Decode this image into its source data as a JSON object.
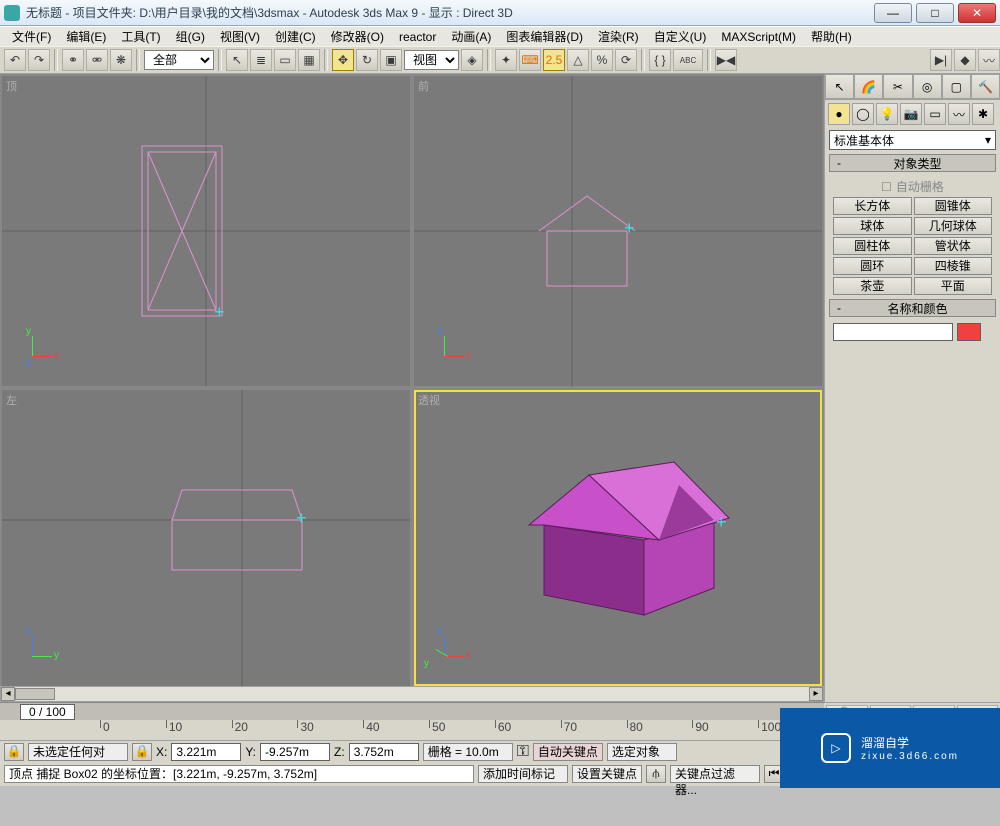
{
  "title": "无标题     - 项目文件夹: D:\\用户目录\\我的文档\\3dsmax      - Autodesk 3ds Max 9       - 显示 : Direct 3D",
  "menu": [
    "文件(F)",
    "编辑(E)",
    "工具(T)",
    "组(G)",
    "视图(V)",
    "创建(C)",
    "修改器(O)",
    "reactor",
    "动画(A)",
    "图表编辑器(D)",
    "渲染(R)",
    "自定义(U)",
    "MAXScript(M)",
    "帮助(H)"
  ],
  "toolbar": {
    "sel_filter": "全部",
    "refspace": "视图"
  },
  "viewports": {
    "top": "顶",
    "front": "前",
    "left": "左",
    "persp": "透视"
  },
  "axes": {
    "x": "x",
    "y": "y",
    "z": "z"
  },
  "timeline": {
    "frame": "0 / 100",
    "ticks": [
      "0",
      "10",
      "20",
      "30",
      "40",
      "50",
      "60",
      "70",
      "80",
      "90",
      "100"
    ]
  },
  "status": {
    "none_selected": "未选定任何对",
    "xl": "X:",
    "xv": "3.221m",
    "yl": "Y:",
    "yv": "-9.257m",
    "zl": "Z:",
    "zv": "3.752m",
    "grid_label": "栅格 = 10.0m",
    "auto_key": "自动关键点",
    "sel_obj": "选定对象",
    "set_key": "设置关键点",
    "key_filter": "关键点过滤器...",
    "prompt_line": "顶点 捕捉 Box02 的坐标位置：[3.221m, -9.257m, 3.752m]",
    "add_time_tag": "添加时间标记"
  },
  "cmdpanel": {
    "category": "标准基本体",
    "rollout_objtype": "对象类型",
    "autogrid": "自动栅格",
    "buttons": [
      [
        "长方体",
        "圆锥体"
      ],
      [
        "球体",
        "几何球体"
      ],
      [
        "圆柱体",
        "管状体"
      ],
      [
        "圆环",
        "四棱锥"
      ],
      [
        "茶壶",
        "平面"
      ]
    ],
    "rollout_name": "名称和颜色"
  },
  "watermark": {
    "main": "溜溜自学",
    "sub": "zixue.3d66.com"
  },
  "snap_val": "2.5"
}
